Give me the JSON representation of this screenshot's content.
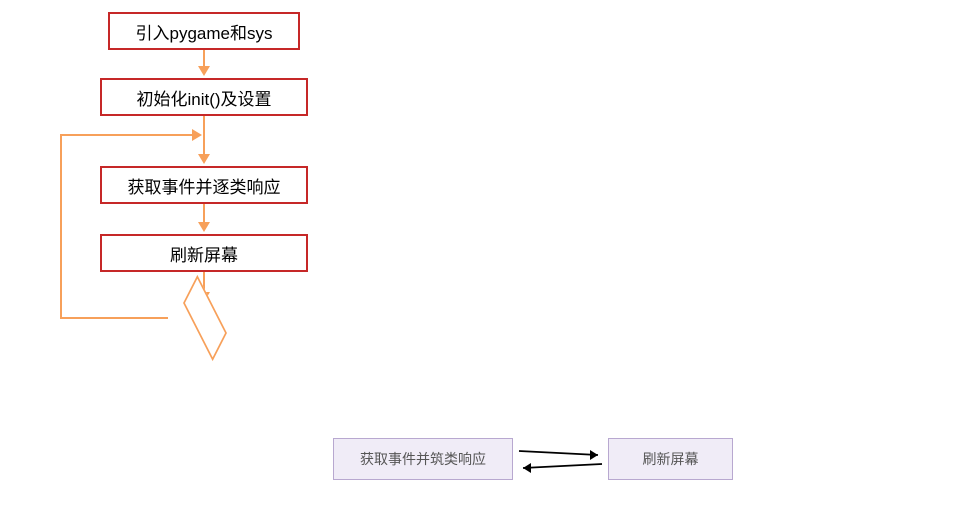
{
  "flowchart": {
    "step1": "引入pygame和sys",
    "step2": "初始化init()及设置",
    "step3": "获取事件并逐类响应",
    "step4": "刷新屏幕"
  },
  "subdiagram": {
    "left": "获取事件并筑类响应",
    "right": "刷新屏幕"
  },
  "chart_data": {
    "type": "flowchart",
    "nodes": [
      {
        "id": "n1",
        "shape": "rect",
        "label": "引入pygame和sys"
      },
      {
        "id": "n2",
        "shape": "rect",
        "label": "初始化init()及设置"
      },
      {
        "id": "n3",
        "shape": "rect",
        "label": "获取事件并逐类响应"
      },
      {
        "id": "n4",
        "shape": "rect",
        "label": "刷新屏幕"
      },
      {
        "id": "n5",
        "shape": "diamond",
        "label": ""
      }
    ],
    "edges": [
      {
        "from": "n1",
        "to": "n2"
      },
      {
        "from": "n2",
        "to": "n3"
      },
      {
        "from": "n3",
        "to": "n4"
      },
      {
        "from": "n4",
        "to": "n5"
      },
      {
        "from": "n5",
        "to": "n3",
        "type": "loopback"
      }
    ],
    "secondary": {
      "nodes": [
        {
          "id": "s1",
          "shape": "rect",
          "label": "获取事件并筑类响应"
        },
        {
          "id": "s2",
          "shape": "rect",
          "label": "刷新屏幕"
        }
      ],
      "edges": [
        {
          "from": "s1",
          "to": "s2",
          "bidirectional": true
        }
      ]
    }
  }
}
